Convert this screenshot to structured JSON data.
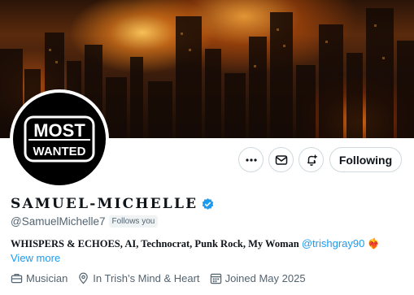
{
  "banner": {
    "description_icon": "burning-city-banner"
  },
  "avatar": {
    "line1": "MOST",
    "line2": "WANTED"
  },
  "actions": {
    "more_icon": "more-icon",
    "message_icon": "mail-icon",
    "notify_icon": "bell-plus-icon",
    "follow_label": "Following"
  },
  "profile": {
    "display_name": "SAMUEL-MICHELLE",
    "verified": true,
    "handle": "@SamuelMichelle7",
    "follows_you": "Follows you",
    "bio_text": "WHISPERS & ECHOES, AI, Technocrat, Punk Rock, My Woman ",
    "bio_mention": "@trishgray90",
    "bio_emoji": "❤️‍🔥",
    "view_more": "View more",
    "profession": "Musician",
    "location": "In Trish’s Mind & Heart",
    "joined": "Joined May 2025"
  },
  "colors": {
    "accent": "#1d9bf0",
    "muted": "#536471",
    "text": "#0f1419"
  }
}
